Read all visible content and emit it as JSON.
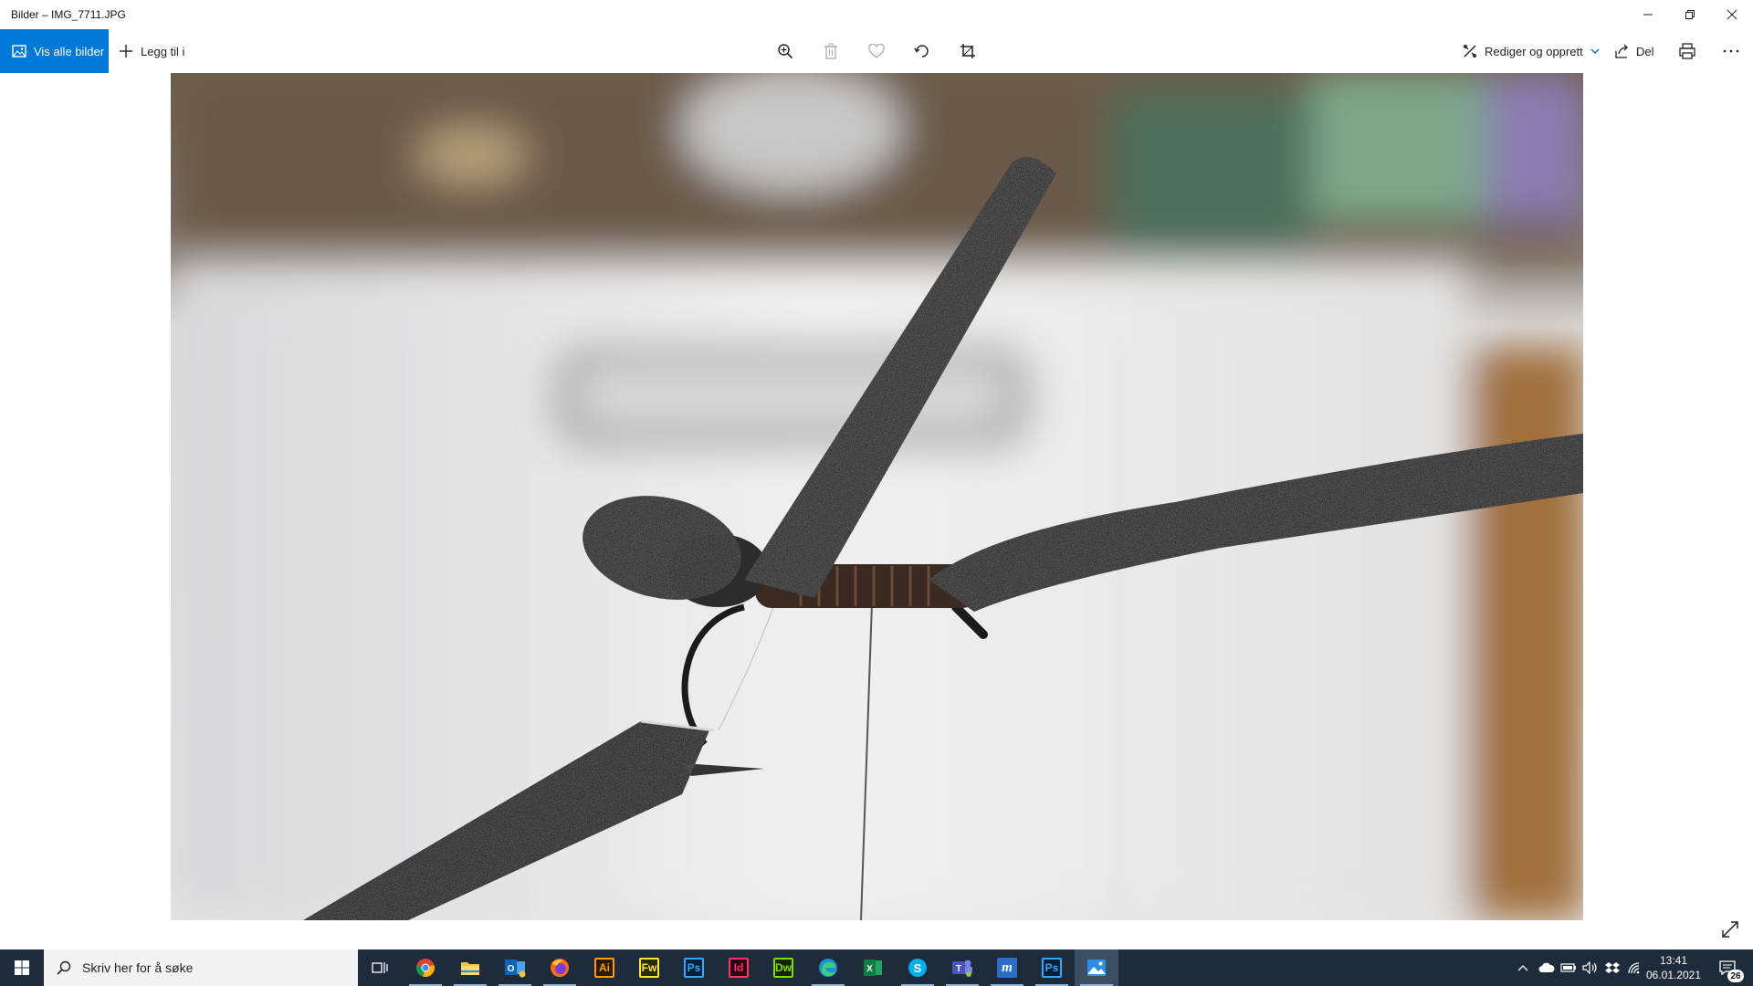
{
  "window": {
    "title": "Bilder – IMG_7711.JPG",
    "controls": [
      "minimize",
      "restore",
      "close"
    ]
  },
  "toolbar": {
    "view_all_label": "Vis alle bilder",
    "add_to_label": "Legg til i",
    "icons": [
      "zoom-icon",
      "delete-icon",
      "favorite-icon",
      "rotate-icon",
      "crop-icon"
    ],
    "edit_create_label": "Rediger og opprett",
    "share_label": "Del",
    "print": "print-icon",
    "more": "more-icon"
  },
  "taskbar": {
    "search_placeholder": "Skriv her for å søke",
    "apps": [
      {
        "name": "Chrome",
        "label": ""
      },
      {
        "name": "File Explorer",
        "label": ""
      },
      {
        "name": "Outlook",
        "label": "O"
      },
      {
        "name": "Firefox",
        "label": ""
      },
      {
        "name": "Illustrator",
        "label": "Ai"
      },
      {
        "name": "Fireworks",
        "label": "Fw"
      },
      {
        "name": "Photoshop",
        "label": "Ps"
      },
      {
        "name": "InDesign",
        "label": "Id"
      },
      {
        "name": "Dreamweaver",
        "label": "Dw"
      },
      {
        "name": "Edge",
        "label": ""
      },
      {
        "name": "Excel",
        "label": "X"
      },
      {
        "name": "Skype",
        "label": "S"
      },
      {
        "name": "Teams",
        "label": "T"
      },
      {
        "name": "App m",
        "label": "m"
      },
      {
        "name": "Photoshop 2",
        "label": "Ps"
      },
      {
        "name": "Photos",
        "label": ""
      }
    ],
    "clock_time": "13:41",
    "clock_date": "06.01.2021",
    "notification_count": "26"
  },
  "colors": {
    "accent": "#0078d7",
    "taskbar": "#1d2b3a",
    "illustrator": "#ff9a00",
    "fireworks": "#f5e82f",
    "photoshop": "#31a8ff",
    "indesign": "#ff3366",
    "dreamweaver": "#7fdc00"
  }
}
